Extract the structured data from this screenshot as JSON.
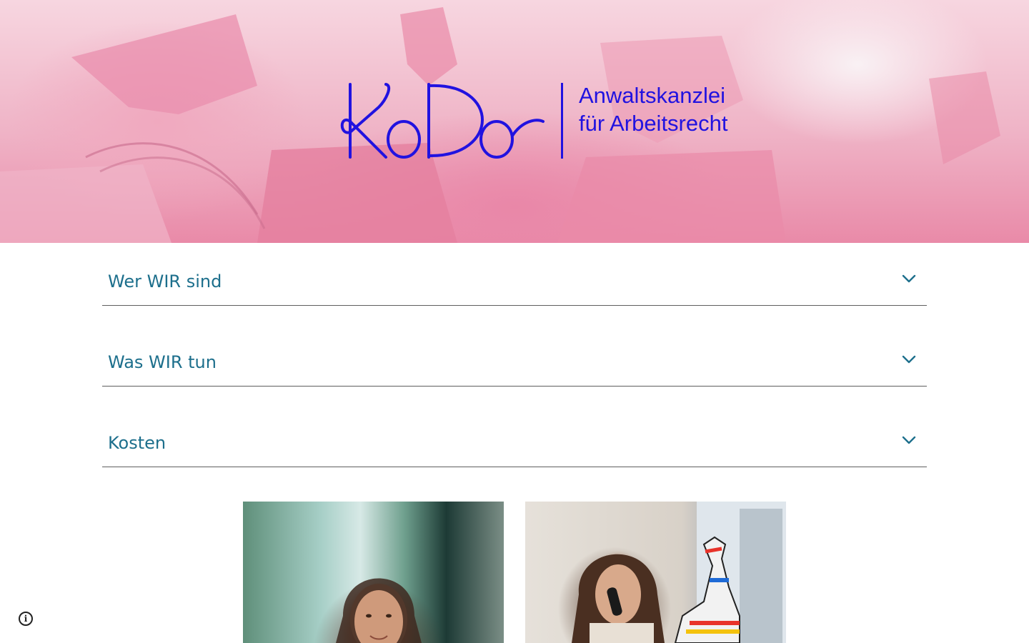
{
  "header": {
    "logo": {
      "wordmark": "KoDo",
      "tagline_line1": "Anwaltskanzlei",
      "tagline_line2": "für Arbeitsrecht",
      "color": "#2112e0"
    }
  },
  "sections": [
    {
      "title": "Wer WIR sind",
      "state": "collapsed"
    },
    {
      "title": "Was WIR tun",
      "state": "collapsed"
    },
    {
      "title": "Kosten",
      "state": "collapsed"
    }
  ],
  "photos": [
    {
      "name": "lawyer-portrait-1"
    },
    {
      "name": "lawyer-portrait-2-on-phone"
    }
  ],
  "footer": {
    "info_icon": "info-icon"
  },
  "colors": {
    "section_title": "#1d6f8c",
    "divider": "#5f5f5f",
    "hero_pink": "#e98aa8"
  }
}
